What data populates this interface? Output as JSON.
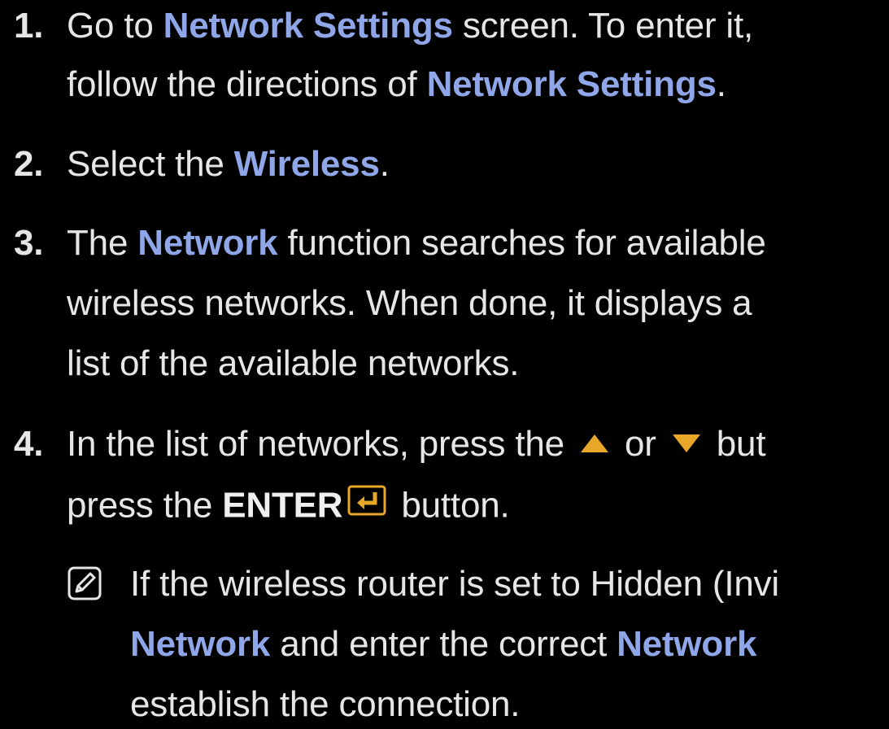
{
  "step1": {
    "number": "1.",
    "line1_a": "Go to ",
    "line1_b": "Network Settings",
    "line1_c": " screen. To enter it,",
    "line2_a": "follow the directions of ",
    "line2_b": "Network Settings",
    "line2_c": "."
  },
  "step2": {
    "number": "2.",
    "a": "Select the ",
    "b": "Wireless",
    "c": "."
  },
  "step3": {
    "number": "3.",
    "line1_a": "The ",
    "line1_b": "Network",
    "line1_c": " function searches for available",
    "line2": "wireless networks. When done, it displays a",
    "line3": "list of the available networks."
  },
  "step4": {
    "number": "4.",
    "line1_a": "In the list of networks, press the ",
    "line1_b": " or ",
    "line1_c": " but",
    "line2_a": "press the ",
    "line2_b": "ENTER",
    "line2_c": " button."
  },
  "note": {
    "line1": "If the wireless router is set to Hidden (Invi",
    "line2_a": "Network",
    "line2_b": " and enter the correct ",
    "line2_c": "Network",
    "line3": "establish the connection."
  },
  "icons": {
    "up": "up-triangle-icon",
    "down": "down-triangle-icon",
    "enter": "enter-icon",
    "note": "note-pencil-icon"
  },
  "colors": {
    "highlight": "#8fa7e8",
    "arrow": "#e9a72a",
    "text": "#e6e6e6",
    "background": "#000000"
  }
}
